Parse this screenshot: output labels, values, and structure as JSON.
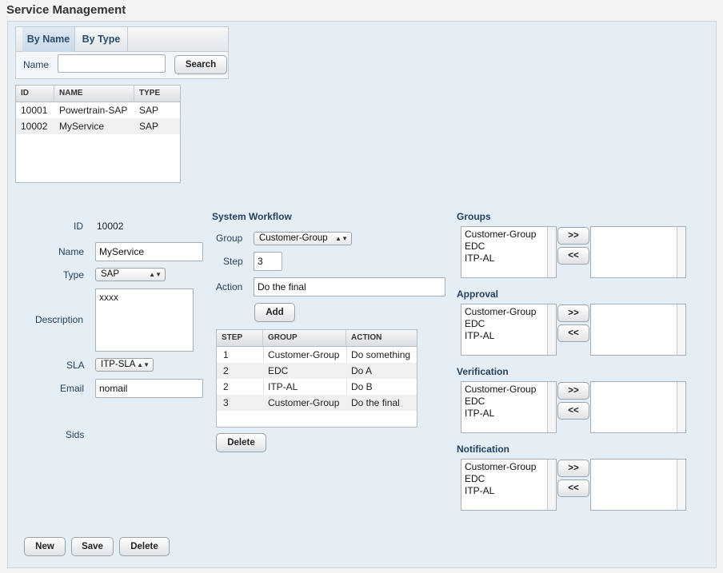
{
  "page": {
    "title": "Service Management"
  },
  "tabs": [
    {
      "label": "By Name"
    },
    {
      "label": "By Type"
    }
  ],
  "search": {
    "label": "Name",
    "value": "",
    "button": "Search"
  },
  "services_table": {
    "headers": [
      "ID",
      "NAME",
      "TYPE"
    ],
    "rows": [
      [
        "10001",
        "Powertrain-SAP",
        "SAP"
      ],
      [
        "10002",
        "MyService",
        "SAP"
      ]
    ]
  },
  "form": {
    "id_label": "ID",
    "id_value": "10002",
    "name_label": "Name",
    "name_value": "MyService",
    "type_label": "Type",
    "type_value": "SAP",
    "description_label": "Description",
    "description_value": "xxxx",
    "sla_label": "SLA",
    "sla_value": "ITP-SLA",
    "email_label": "Email",
    "email_value": "nomail",
    "sids_label": "Sids"
  },
  "workflow": {
    "title": "System Workflow",
    "group_label": "Group",
    "group_value": "Customer-Group",
    "step_label": "Step",
    "step_value": "3",
    "action_label": "Action",
    "action_value": "Do the final",
    "add_button": "Add",
    "table": {
      "headers": [
        "STEP",
        "GROUP",
        "ACTION"
      ],
      "rows": [
        [
          "1",
          "Customer-Group",
          "Do something"
        ],
        [
          "2",
          "EDC",
          "Do A"
        ],
        [
          "2",
          "ITP-AL",
          "Do B"
        ],
        [
          "3",
          "Customer-Group",
          "Do the final"
        ]
      ]
    },
    "delete_button": "Delete"
  },
  "assignments": [
    {
      "title": "Groups",
      "options": [
        "Customer-Group",
        "EDC",
        "ITP-AL"
      ],
      "add": ">>",
      "remove": "<<"
    },
    {
      "title": "Approval",
      "options": [
        "Customer-Group",
        "EDC",
        "ITP-AL"
      ],
      "add": ">>",
      "remove": "<<"
    },
    {
      "title": "Verification",
      "options": [
        "Customer-Group",
        "EDC",
        "ITP-AL"
      ],
      "add": ">>",
      "remove": "<<"
    },
    {
      "title": "Notification",
      "options": [
        "Customer-Group",
        "EDC",
        "ITP-AL"
      ],
      "add": ">>",
      "remove": "<<"
    }
  ],
  "footer": {
    "new_button": "New",
    "save_button": "Save",
    "delete_button": "Delete"
  }
}
